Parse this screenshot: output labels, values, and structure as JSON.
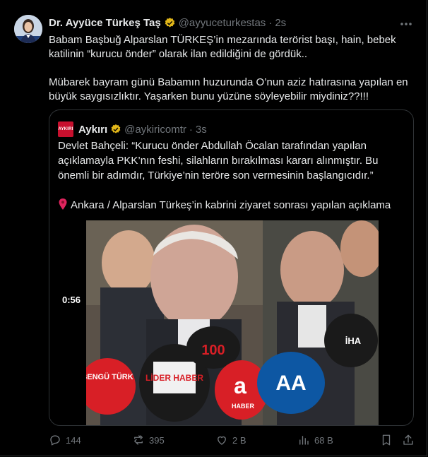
{
  "tweet": {
    "author_name": "Dr. Ayyüce Türkeş Taş",
    "handle": "@ayyuceturkestas",
    "separator": "·",
    "time": "2s",
    "paragraph1": "Babam Başbuğ Alparslan TÜRKEŞ’in mezarında terörist başı, hain, bebek katilinin “kurucu önder” olarak ilan edildiğini de gördük..",
    "paragraph2": "Mübarek bayram günü Babamın huzurunda O’nun aziz hatırasına yapılan en büyük saygısızlıktır. Yaşarken bunu yüzüne söyleyebilir miydiniz??!!!"
  },
  "quote": {
    "logo_text": "AYKIRI",
    "author_name": "Aykırı",
    "handle": "@aykiricomtr",
    "separator": "·",
    "time": "3s",
    "paragraph1": "Devlet Bahçeli: “Kurucu önder Abdullah Öcalan tarafından yapılan açıklamayla PKK’nın feshi, silahların bırakılması kararı alınmıştır. Bu önemli bir adımdır, Türkiye’nin teröre son vermesinin başlangıcıdır.”",
    "paragraph2": "Ankara / Alparslan Türkeş’in kabrini ziyaret sonrası yapılan açıklama",
    "video_duration": "0:56",
    "mic_labels": {
      "bengu": "BENGÜ TÜRK",
      "lider": "LİDER HABER",
      "a": "a",
      "a_haber": "HABER",
      "aa": "AA",
      "iha": "İHA",
      "num": "100"
    }
  },
  "actions": {
    "replies": "144",
    "reposts": "395",
    "likes": "2 B",
    "views": "68 B"
  },
  "colors": {
    "background": "#000000",
    "text": "#e7e9ea",
    "muted": "#71767b",
    "border": "#2f3336",
    "verified": "#e2b719"
  }
}
